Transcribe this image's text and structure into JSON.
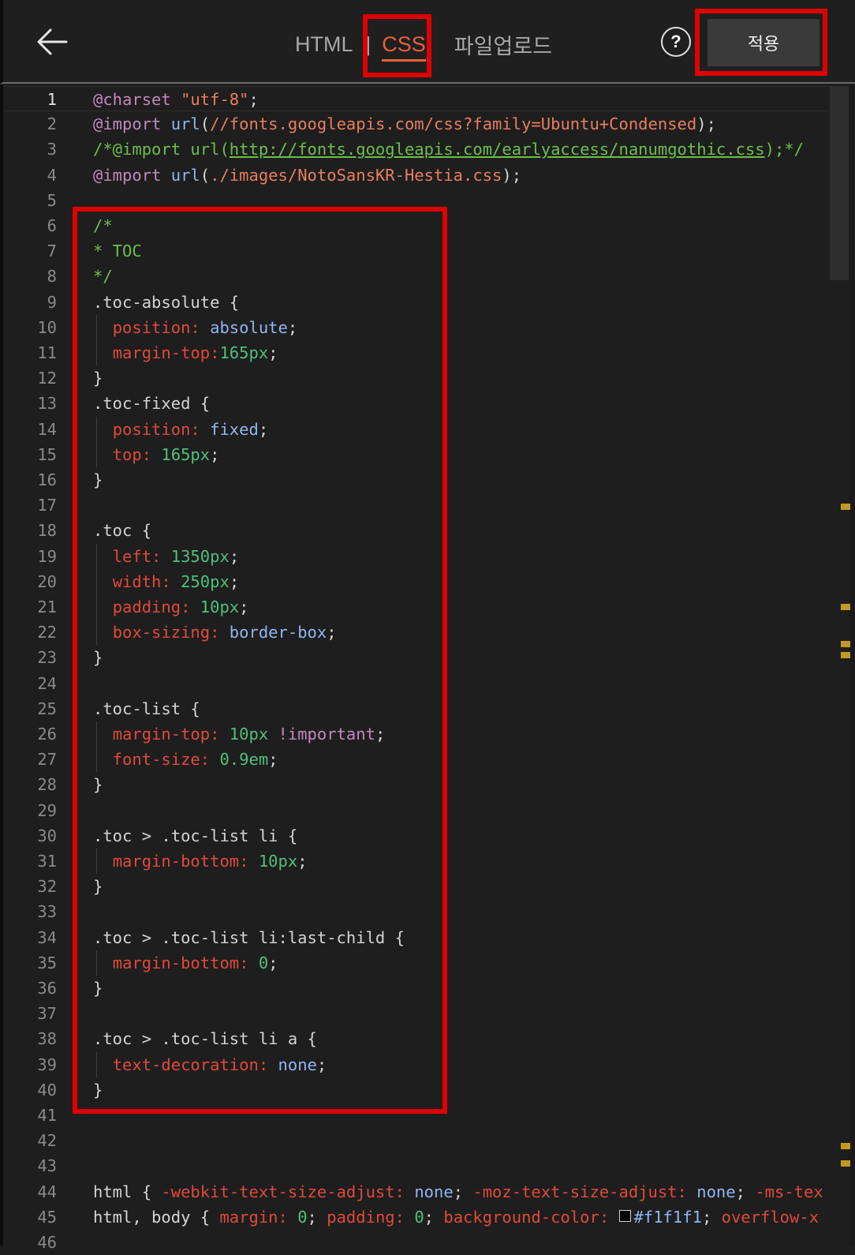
{
  "header": {
    "tabs": {
      "html": "HTML",
      "separator": "|",
      "css": "CSS",
      "upload": "파일업로드"
    },
    "help_label": "?",
    "apply_label": "적용"
  },
  "colors": {
    "background": "#1e1e1e",
    "accent": "#e8603c",
    "highlight_box": "#e00000",
    "at_rule": "#c586c0",
    "property": "#e04a3a",
    "number": "#4ec07a",
    "keyword_value": "#8fb6f0",
    "string": "#e87e5e",
    "comment": "#6cbf4a"
  },
  "editor": {
    "active_line": 1,
    "lines": [
      {
        "n": "1",
        "seg": [
          {
            "t": "@charset",
            "c": "at"
          },
          {
            "t": " "
          },
          {
            "t": "\"utf-8\"",
            "c": "str"
          },
          {
            "t": ";"
          }
        ]
      },
      {
        "n": "2",
        "seg": [
          {
            "t": "@import",
            "c": "at"
          },
          {
            "t": " "
          },
          {
            "t": "url",
            "c": "fn"
          },
          {
            "t": "("
          },
          {
            "t": "//fonts.googleapis.com/css?family=Ubuntu+Condensed",
            "c": "str"
          },
          {
            "t": ");"
          }
        ]
      },
      {
        "n": "3",
        "seg": [
          {
            "t": "/*@import url(",
            "c": "cmt"
          },
          {
            "t": "http://fonts.googleapis.com/earlyaccess/nanumgothic.css",
            "c": "cmtlink"
          },
          {
            "t": ");*/",
            "c": "cmt"
          }
        ]
      },
      {
        "n": "4",
        "seg": [
          {
            "t": "@import",
            "c": "at"
          },
          {
            "t": " "
          },
          {
            "t": "url",
            "c": "fn"
          },
          {
            "t": "("
          },
          {
            "t": "./images/NotoSansKR-Hestia.css",
            "c": "str"
          },
          {
            "t": ");"
          }
        ]
      },
      {
        "n": "5",
        "seg": []
      },
      {
        "n": "6",
        "seg": [
          {
            "t": "/*",
            "c": "cmt"
          }
        ]
      },
      {
        "n": "7",
        "seg": [
          {
            "t": "* TOC",
            "c": "cmt"
          }
        ]
      },
      {
        "n": "8",
        "seg": [
          {
            "t": "*/",
            "c": "cmt"
          }
        ]
      },
      {
        "n": "9",
        "seg": [
          {
            "t": ".toc-absolute",
            "c": "sel"
          },
          {
            "t": " {"
          }
        ]
      },
      {
        "n": "10",
        "ind": true,
        "seg": [
          {
            "t": "  "
          },
          {
            "t": "position:",
            "c": "prop"
          },
          {
            "t": " "
          },
          {
            "t": "absolute",
            "c": "kw"
          },
          {
            "t": ";"
          }
        ]
      },
      {
        "n": "11",
        "ind": true,
        "seg": [
          {
            "t": "  "
          },
          {
            "t": "margin-top:",
            "c": "prop"
          },
          {
            "t": "165px",
            "c": "num"
          },
          {
            "t": ";"
          }
        ]
      },
      {
        "n": "12",
        "seg": [
          {
            "t": "}"
          }
        ]
      },
      {
        "n": "13",
        "seg": [
          {
            "t": ".toc-fixed",
            "c": "sel"
          },
          {
            "t": " {"
          }
        ]
      },
      {
        "n": "14",
        "ind": true,
        "seg": [
          {
            "t": "  "
          },
          {
            "t": "position:",
            "c": "prop"
          },
          {
            "t": " "
          },
          {
            "t": "fixed",
            "c": "kw"
          },
          {
            "t": ";"
          }
        ]
      },
      {
        "n": "15",
        "ind": true,
        "seg": [
          {
            "t": "  "
          },
          {
            "t": "top:",
            "c": "prop"
          },
          {
            "t": " "
          },
          {
            "t": "165px",
            "c": "num"
          },
          {
            "t": ";"
          }
        ]
      },
      {
        "n": "16",
        "seg": [
          {
            "t": "}"
          }
        ]
      },
      {
        "n": "17",
        "seg": []
      },
      {
        "n": "18",
        "seg": [
          {
            "t": ".toc",
            "c": "sel"
          },
          {
            "t": " {"
          }
        ]
      },
      {
        "n": "19",
        "ind": true,
        "seg": [
          {
            "t": "  "
          },
          {
            "t": "left:",
            "c": "prop"
          },
          {
            "t": " "
          },
          {
            "t": "1350px",
            "c": "num"
          },
          {
            "t": ";"
          }
        ]
      },
      {
        "n": "20",
        "ind": true,
        "seg": [
          {
            "t": "  "
          },
          {
            "t": "width:",
            "c": "prop"
          },
          {
            "t": " "
          },
          {
            "t": "250px",
            "c": "num"
          },
          {
            "t": ";"
          }
        ]
      },
      {
        "n": "21",
        "ind": true,
        "seg": [
          {
            "t": "  "
          },
          {
            "t": "padding:",
            "c": "prop"
          },
          {
            "t": " "
          },
          {
            "t": "10px",
            "c": "num"
          },
          {
            "t": ";"
          }
        ]
      },
      {
        "n": "22",
        "ind": true,
        "seg": [
          {
            "t": "  "
          },
          {
            "t": "box-sizing:",
            "c": "prop"
          },
          {
            "t": " "
          },
          {
            "t": "border-box",
            "c": "kw"
          },
          {
            "t": ";"
          }
        ]
      },
      {
        "n": "23",
        "seg": [
          {
            "t": "}"
          }
        ]
      },
      {
        "n": "24",
        "seg": []
      },
      {
        "n": "25",
        "seg": [
          {
            "t": ".toc-list",
            "c": "sel"
          },
          {
            "t": " {"
          }
        ]
      },
      {
        "n": "26",
        "ind": true,
        "seg": [
          {
            "t": "  "
          },
          {
            "t": "margin-top:",
            "c": "prop"
          },
          {
            "t": " "
          },
          {
            "t": "10px",
            "c": "num"
          },
          {
            "t": " "
          },
          {
            "t": "!important",
            "c": "at"
          },
          {
            "t": ";"
          }
        ]
      },
      {
        "n": "27",
        "ind": true,
        "seg": [
          {
            "t": "  "
          },
          {
            "t": "font-size:",
            "c": "prop"
          },
          {
            "t": " "
          },
          {
            "t": "0.9em",
            "c": "num"
          },
          {
            "t": ";"
          }
        ]
      },
      {
        "n": "28",
        "seg": [
          {
            "t": "}"
          }
        ]
      },
      {
        "n": "29",
        "seg": []
      },
      {
        "n": "30",
        "seg": [
          {
            "t": ".toc > .toc-list li",
            "c": "sel"
          },
          {
            "t": " {"
          }
        ]
      },
      {
        "n": "31",
        "ind": true,
        "seg": [
          {
            "t": "  "
          },
          {
            "t": "margin-bottom:",
            "c": "prop"
          },
          {
            "t": " "
          },
          {
            "t": "10px",
            "c": "num"
          },
          {
            "t": ";"
          }
        ]
      },
      {
        "n": "32",
        "seg": [
          {
            "t": "}"
          }
        ]
      },
      {
        "n": "33",
        "seg": []
      },
      {
        "n": "34",
        "seg": [
          {
            "t": ".toc > .toc-list li:last-child",
            "c": "sel"
          },
          {
            "t": " {"
          }
        ]
      },
      {
        "n": "35",
        "ind": true,
        "seg": [
          {
            "t": "  "
          },
          {
            "t": "margin-bottom:",
            "c": "prop"
          },
          {
            "t": " "
          },
          {
            "t": "0",
            "c": "num"
          },
          {
            "t": ";"
          }
        ]
      },
      {
        "n": "36",
        "seg": [
          {
            "t": "}"
          }
        ]
      },
      {
        "n": "37",
        "seg": []
      },
      {
        "n": "38",
        "seg": [
          {
            "t": ".toc > .toc-list li a",
            "c": "sel"
          },
          {
            "t": " {"
          }
        ]
      },
      {
        "n": "39",
        "ind": true,
        "seg": [
          {
            "t": "  "
          },
          {
            "t": "text-decoration:",
            "c": "prop"
          },
          {
            "t": " "
          },
          {
            "t": "none",
            "c": "kw"
          },
          {
            "t": ";"
          }
        ]
      },
      {
        "n": "40",
        "seg": [
          {
            "t": "}"
          }
        ]
      },
      {
        "n": "41",
        "seg": []
      },
      {
        "n": "42",
        "seg": []
      },
      {
        "n": "43",
        "seg": []
      },
      {
        "n": "44",
        "seg": [
          {
            "t": "html",
            "c": "sel"
          },
          {
            "t": " { "
          },
          {
            "t": "-webkit-text-size-adjust:",
            "c": "prop"
          },
          {
            "t": " "
          },
          {
            "t": "none",
            "c": "kw"
          },
          {
            "t": "; "
          },
          {
            "t": "-moz-text-size-adjust:",
            "c": "prop"
          },
          {
            "t": " "
          },
          {
            "t": "none",
            "c": "kw"
          },
          {
            "t": "; "
          },
          {
            "t": "-ms-tex",
            "c": "prop"
          }
        ]
      },
      {
        "n": "45",
        "seg": [
          {
            "t": "html, body",
            "c": "sel"
          },
          {
            "t": " { "
          },
          {
            "t": "margin:",
            "c": "prop"
          },
          {
            "t": " "
          },
          {
            "t": "0",
            "c": "num"
          },
          {
            "t": "; "
          },
          {
            "t": "padding:",
            "c": "prop"
          },
          {
            "t": " "
          },
          {
            "t": "0",
            "c": "num"
          },
          {
            "t": "; "
          },
          {
            "t": "background-color:",
            "c": "prop"
          },
          {
            "t": " "
          },
          {
            "sw": true,
            "t": "#f1f1f1",
            "c": "kw"
          },
          {
            "t": "; "
          },
          {
            "t": "overflow-x",
            "c": "prop"
          }
        ]
      },
      {
        "n": "46",
        "seg": []
      }
    ]
  }
}
